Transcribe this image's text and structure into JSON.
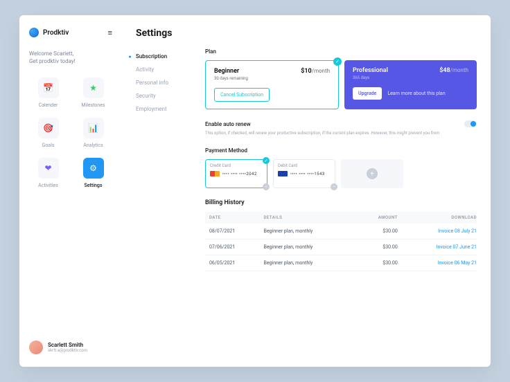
{
  "brand": "Prodktiv",
  "welcome_line1": "Welcome Scarlett,",
  "welcome_line2": "Get prodktiv today!",
  "nav": [
    {
      "label": "Calender",
      "icon": "📅"
    },
    {
      "label": "Milestones",
      "icon": "★"
    },
    {
      "label": "Goals",
      "icon": "🎯"
    },
    {
      "label": "Analytics",
      "icon": "📊"
    },
    {
      "label": "Activities",
      "icon": "❤"
    },
    {
      "label": "Settings",
      "icon": "⚙"
    }
  ],
  "user": {
    "name": "Scarlett Smith",
    "email": "skrtt.a@prodktiv.com"
  },
  "page_title": "Settings",
  "subnav": [
    "Subscription",
    "Activity",
    "Personal info",
    "Security",
    "Employment"
  ],
  "sections": {
    "plan": "Plan",
    "auto": "Enable auto renew",
    "pm": "Payment Method",
    "bill": "Billing History"
  },
  "plans": {
    "current": {
      "name": "Beginner",
      "sub": "30 days remaining",
      "price": "$10",
      "period": "/month",
      "action": "Cancel Subscription"
    },
    "other": {
      "name": "Professional",
      "sub": "365 days",
      "price": "$48",
      "period": "/month",
      "action": "Upgrade",
      "link": "Learn more about this plan"
    }
  },
  "auto_desc": "This option, if checked, will renew your productive subscription, if the current plan expires. However, this might prevent you from",
  "pm": [
    {
      "type": "Credit Card",
      "num": "•••• •••• ••••2042"
    },
    {
      "type": "Debit Card",
      "num": "•••• •••• ••••1543"
    }
  ],
  "bill_cols": {
    "date": "DATE",
    "details": "DETAILS",
    "amount": "AMOUNT",
    "download": "DOWNLOAD"
  },
  "bill_rows": [
    {
      "date": "08/07/2021",
      "details": "Beginner plan, monthly",
      "amount": "$30.00",
      "dl": "Invoice 08 July 21"
    },
    {
      "date": "07/06/2021",
      "details": "Beginner plan, monthly",
      "amount": "$30.00",
      "dl": "Invoice 07 June 21"
    },
    {
      "date": "06/05/2021",
      "details": "Beginner plan, monthly",
      "amount": "$30.00",
      "dl": "Invoice 06 May 21"
    }
  ]
}
